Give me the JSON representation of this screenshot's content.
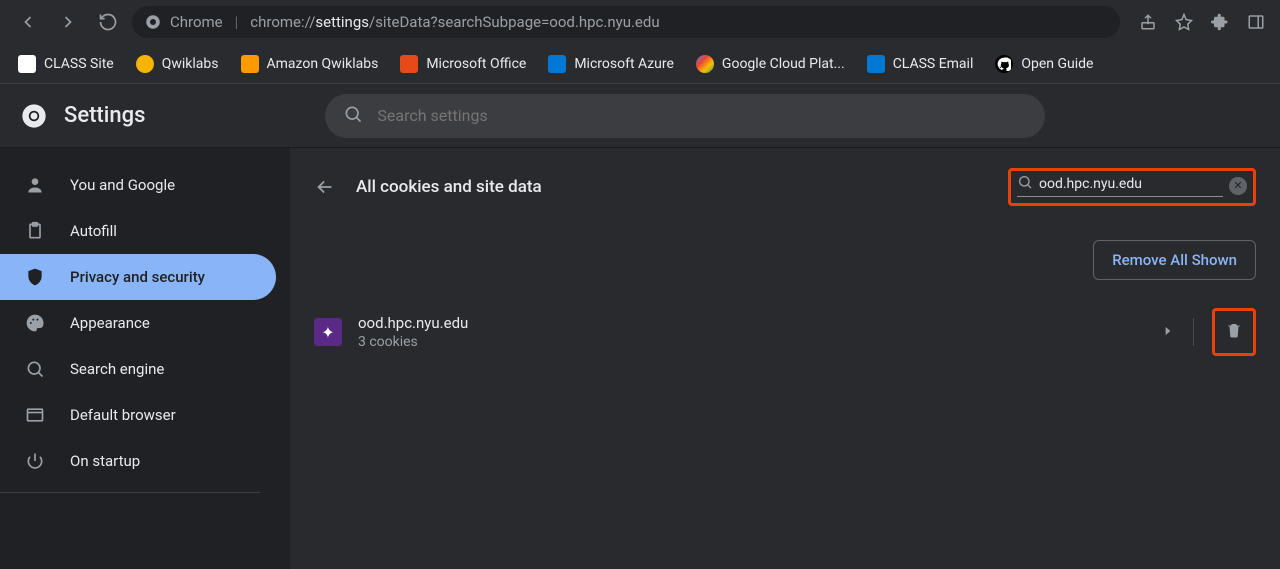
{
  "browser": {
    "address_label": "Chrome",
    "url_prefix": "chrome://",
    "url_bold": "settings",
    "url_suffix": "/siteData?searchSubpage=ood.hpc.nyu.edu"
  },
  "bookmarks": [
    {
      "label": "CLASS Site",
      "color": "#ffffff"
    },
    {
      "label": "Qwiklabs",
      "color": "#f4b400"
    },
    {
      "label": "Amazon Qwiklabs",
      "color": "#ff9900"
    },
    {
      "label": "Microsoft Office",
      "color": "#e64a19"
    },
    {
      "label": "Microsoft Azure",
      "color": "#0078d4"
    },
    {
      "label": "Google Cloud Plat...",
      "color": "#4285f4"
    },
    {
      "label": "CLASS Email",
      "color": "#0078d4"
    },
    {
      "label": "Open Guide",
      "color": "#ffffff"
    }
  ],
  "settings": {
    "title": "Settings",
    "search_placeholder": "Search settings"
  },
  "sidebar": {
    "items": [
      {
        "label": "You and Google"
      },
      {
        "label": "Autofill"
      },
      {
        "label": "Privacy and security"
      },
      {
        "label": "Appearance"
      },
      {
        "label": "Search engine"
      },
      {
        "label": "Default browser"
      },
      {
        "label": "On startup"
      }
    ],
    "active_index": 2
  },
  "page": {
    "title": "All cookies and site data",
    "cookie_search_value": "ood.hpc.nyu.edu",
    "remove_all_label": "Remove All Shown"
  },
  "site": {
    "name": "ood.hpc.nyu.edu",
    "count_label": "3 cookies"
  }
}
